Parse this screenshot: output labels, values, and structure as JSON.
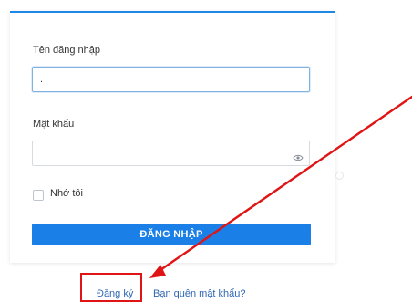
{
  "login_form": {
    "username_label": "Tên đăng nhập",
    "username_value": ".",
    "password_label": "Mật khẩu",
    "password_value": "",
    "remember_label": "Nhớ tôi",
    "remember_checked": false,
    "login_button_label": "ĐĂNG NHẬP"
  },
  "links": {
    "register": "Đăng ký",
    "forgot_password": "Bạn quên mật khẩu?"
  },
  "icons": {
    "password_toggle": "eye-icon"
  },
  "colors": {
    "accent": "#1a7fe6",
    "link": "#2f67b5",
    "annotation": "#e01414"
  }
}
